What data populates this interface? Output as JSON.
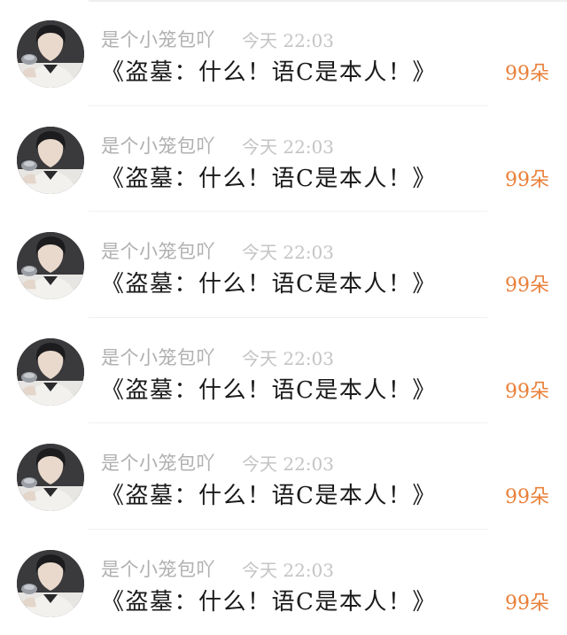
{
  "messages": [
    {
      "username": "是个小笼包吖",
      "time": "今天 22:03",
      "text": "《盗墓：什么！语C是本人！》",
      "flowers": "99朵"
    },
    {
      "username": "是个小笼包吖",
      "time": "今天 22:03",
      "text": "《盗墓：什么！语C是本人！》",
      "flowers": "99朵"
    },
    {
      "username": "是个小笼包吖",
      "time": "今天 22:03",
      "text": "《盗墓：什么！语C是本人！》",
      "flowers": "99朵"
    },
    {
      "username": "是个小笼包吖",
      "time": "今天 22:03",
      "text": "《盗墓：什么！语C是本人！》",
      "flowers": "99朵"
    },
    {
      "username": "是个小笼包吖",
      "time": "今天 22:03",
      "text": "《盗墓：什么！语C是本人！》",
      "flowers": "99朵"
    },
    {
      "username": "是个小笼包吖",
      "time": "今天 22:03",
      "text": "《盗墓：什么！语C是本人！》",
      "flowers": "99朵"
    }
  ],
  "colors": {
    "username": "#b0b0b0",
    "time": "#c4c4c4",
    "message": "#1a1a1a",
    "flowers_accent": "#e9803a",
    "divider": "#f0f0f0"
  },
  "icons": {
    "avatar": "user-avatar-photo"
  }
}
